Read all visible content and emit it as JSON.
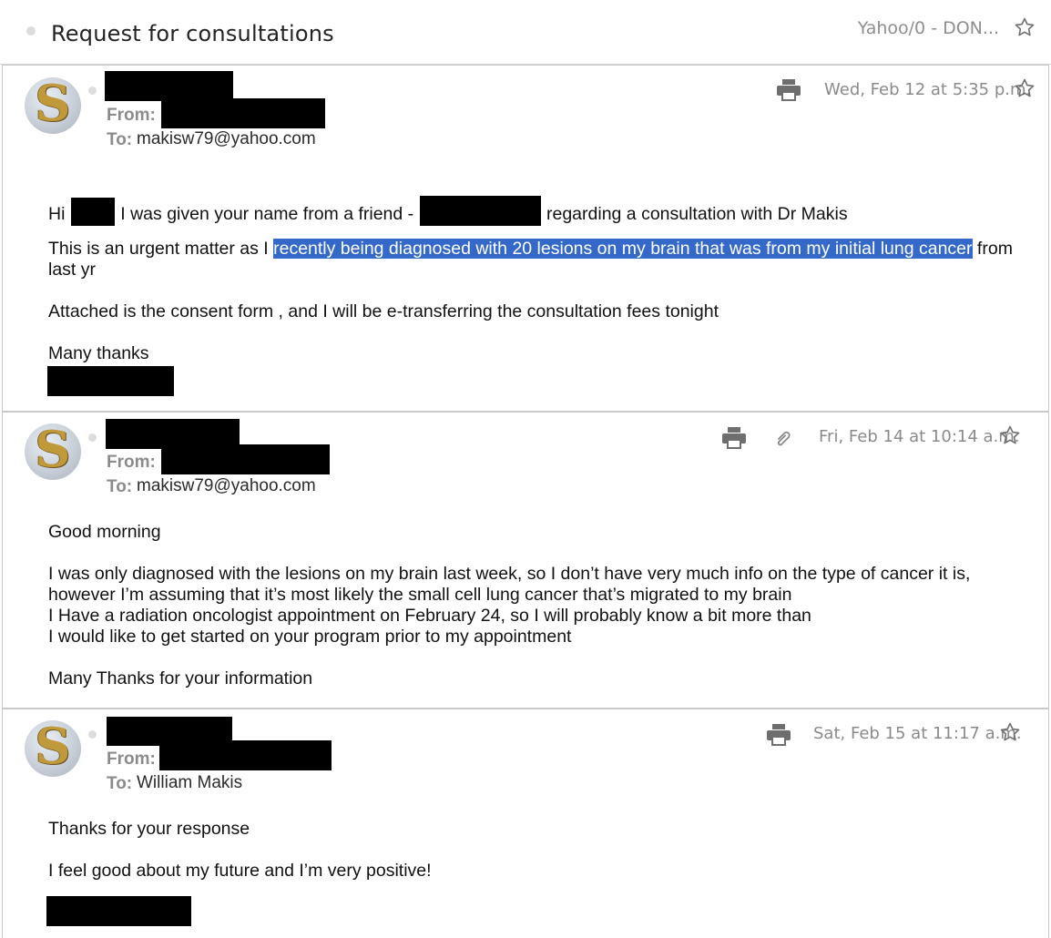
{
  "thread": {
    "title": "Request for consultations",
    "folder": "Yahoo/0 - DON..."
  },
  "labels": {
    "from": "From:",
    "to": "To:"
  },
  "messages": [
    {
      "date": "Wed, Feb 12 at 5:35 p.m.",
      "to": "makisw79@yahoo.com",
      "line1": {
        "a": "Hi",
        "b": "I was given your name from a friend -",
        "c": "regarding a consultation with Dr Makis"
      },
      "line2": {
        "a": "This is an urgent matter as I ",
        "highlight": "recently being diagnosed with 20 lesions on my brain that was from my initial lung cancer",
        "b": " from"
      },
      "line3": "last yr",
      "line4": "Attached is the consent form , and I will be e-transferring the consultation fees tonight",
      "line5": "Many thanks"
    },
    {
      "date": "Fri, Feb 14 at 10:14 a.m.",
      "to": "makisw79@yahoo.com",
      "lines": [
        "Good morning",
        "I was only diagnosed with the lesions on my brain last week, so I don’t have very much info on the type of cancer it is,",
        "however I’m assuming that it’s most likely the small cell lung cancer that’s migrated to my brain",
        "I Have a radiation oncologist appointment on February 24, so I will probably know a bit more than",
        "I would like to get started on your program prior to my appointment",
        "Many Thanks for your information"
      ]
    },
    {
      "date": "Sat, Feb 15 at 11:17 a.m.",
      "to": "William Makis",
      "lines": [
        "Thanks for your response",
        "I feel good about my future and I’m very positive!"
      ]
    }
  ],
  "icons": {
    "star": "star-outline-icon",
    "print": "printer-icon",
    "attachment": "paperclip-icon",
    "avatar_letter": "S"
  },
  "colors": {
    "highlight": "#3569c9",
    "meta_gray": "#8a8a8a"
  }
}
